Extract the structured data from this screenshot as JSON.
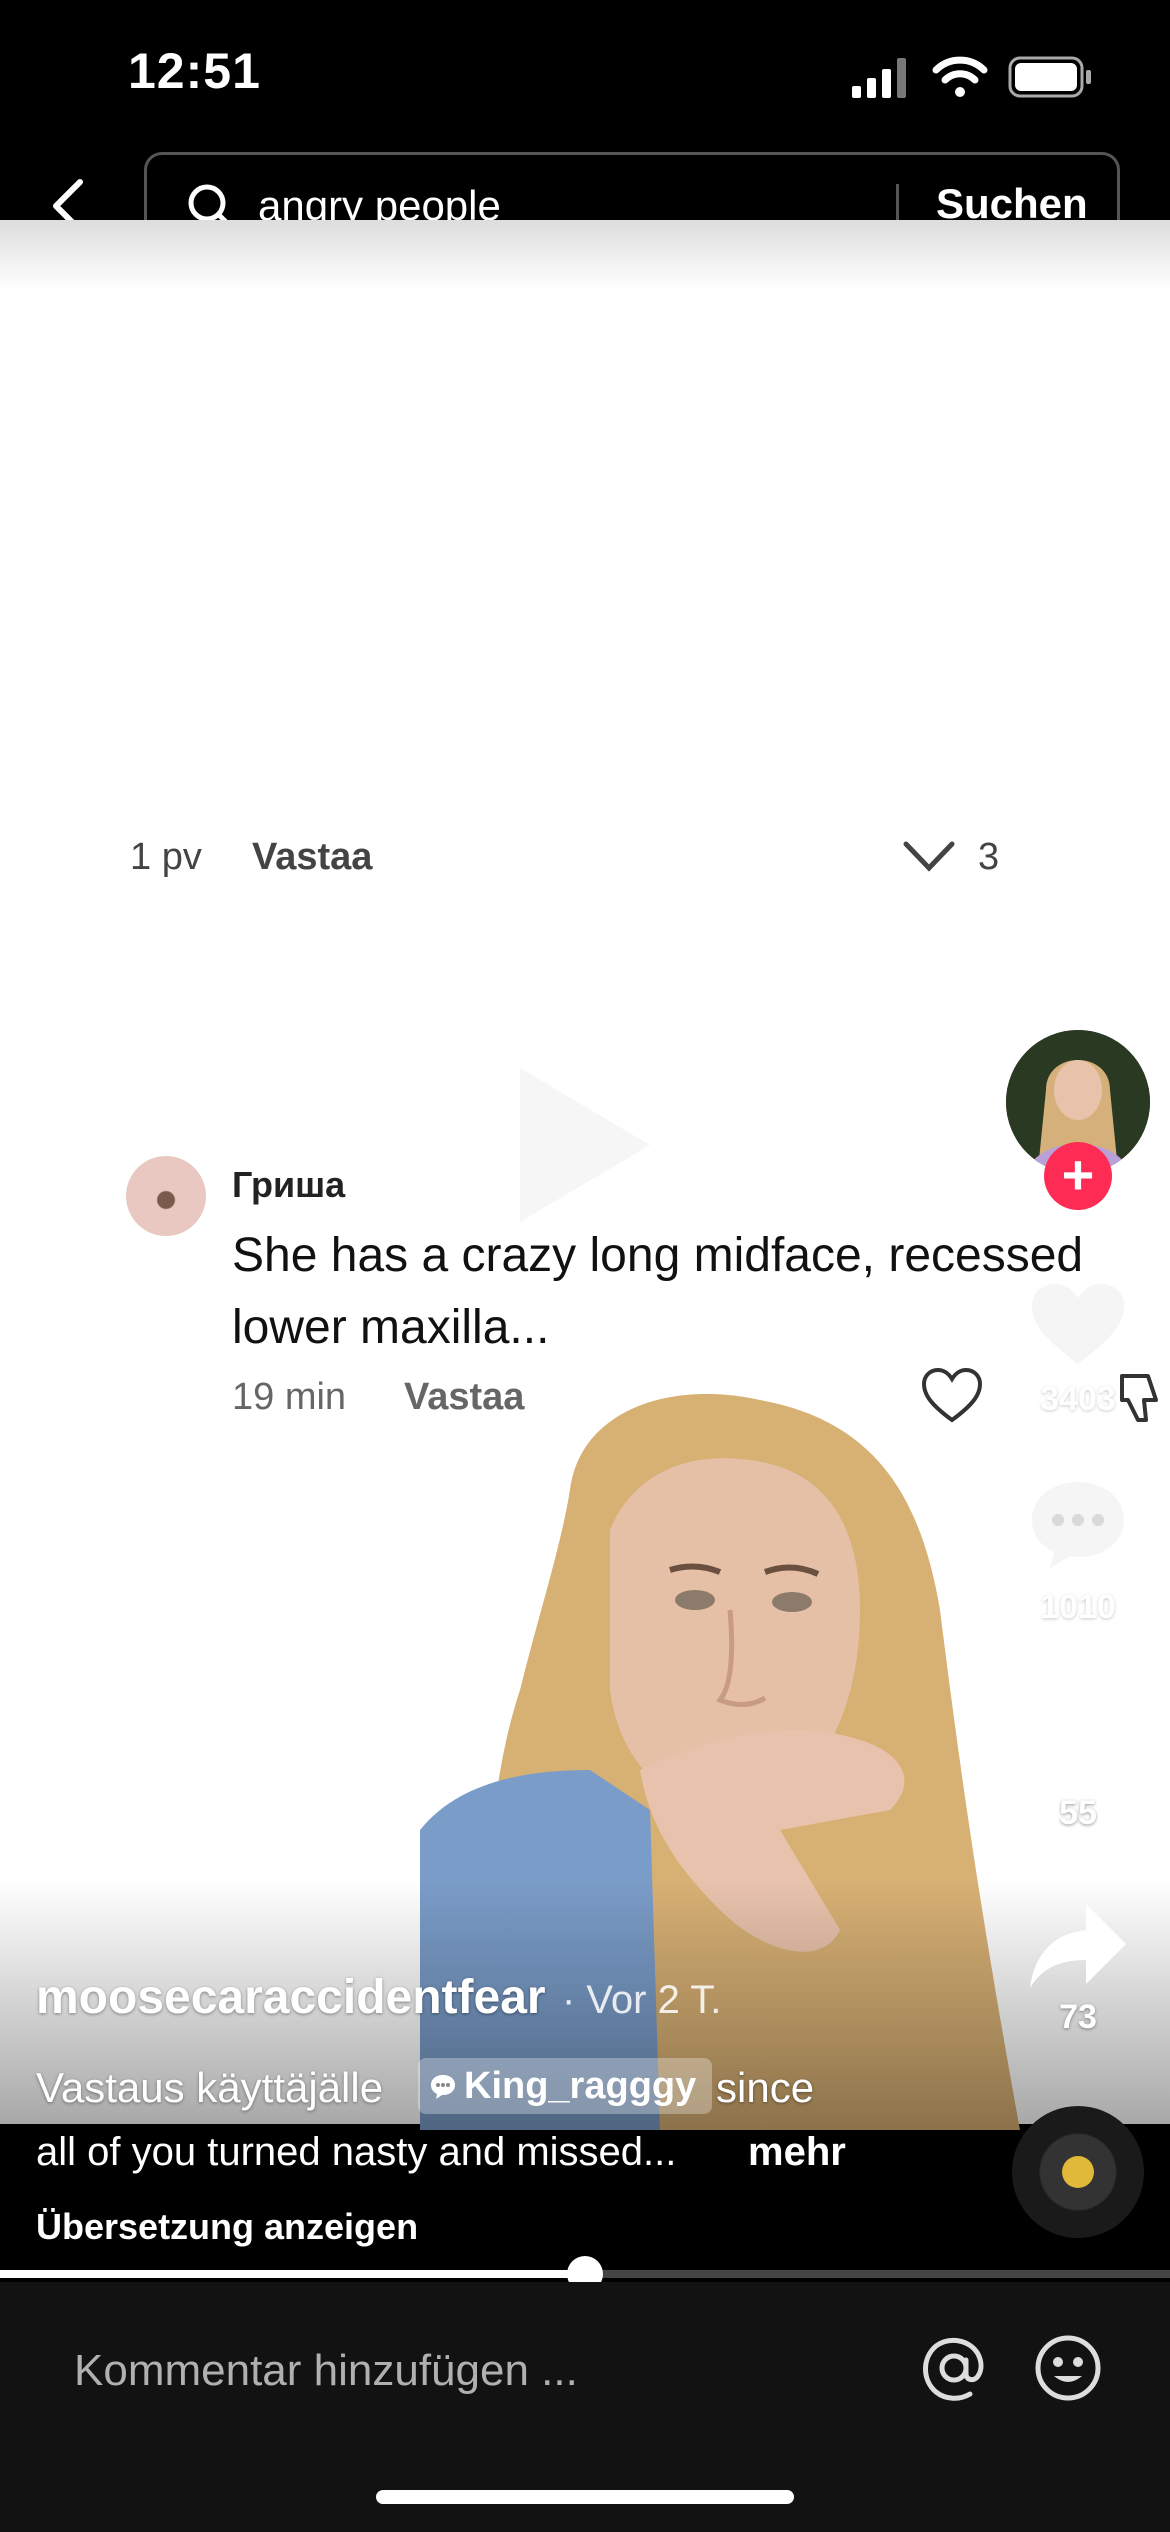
{
  "status_bar": {
    "time": "12:51"
  },
  "search": {
    "query": "angry people",
    "button_label": "Suchen"
  },
  "comment_overlay": {
    "previous": {
      "time": "1 pv",
      "reply": "Vastaa",
      "count": "3"
    },
    "comment": {
      "username": "Гриша",
      "text": "She has a crazy long midface, recessed lower maxilla...",
      "time": "19 min",
      "reply": "Vastaa"
    }
  },
  "rail": {
    "likes": "3403",
    "comments": "1010",
    "bookmarks": "55",
    "shares": "73"
  },
  "post": {
    "author": "moosecaraccidentfear",
    "age": "· Vor 2 T.",
    "caption_prefix": "Vastaus käyttäjälle",
    "mention": "King_ragggy",
    "caption_suffix": "since",
    "caption_line2": "all of you turned nasty and missed...",
    "more_label": "mehr",
    "translate_label": "Übersetzung anzeigen"
  },
  "progress": 0.5,
  "comment_input": {
    "placeholder": "Kommentar hinzufügen ..."
  },
  "colors": {
    "accent": "#fe2c55",
    "music_dot": "#e0b83a"
  }
}
